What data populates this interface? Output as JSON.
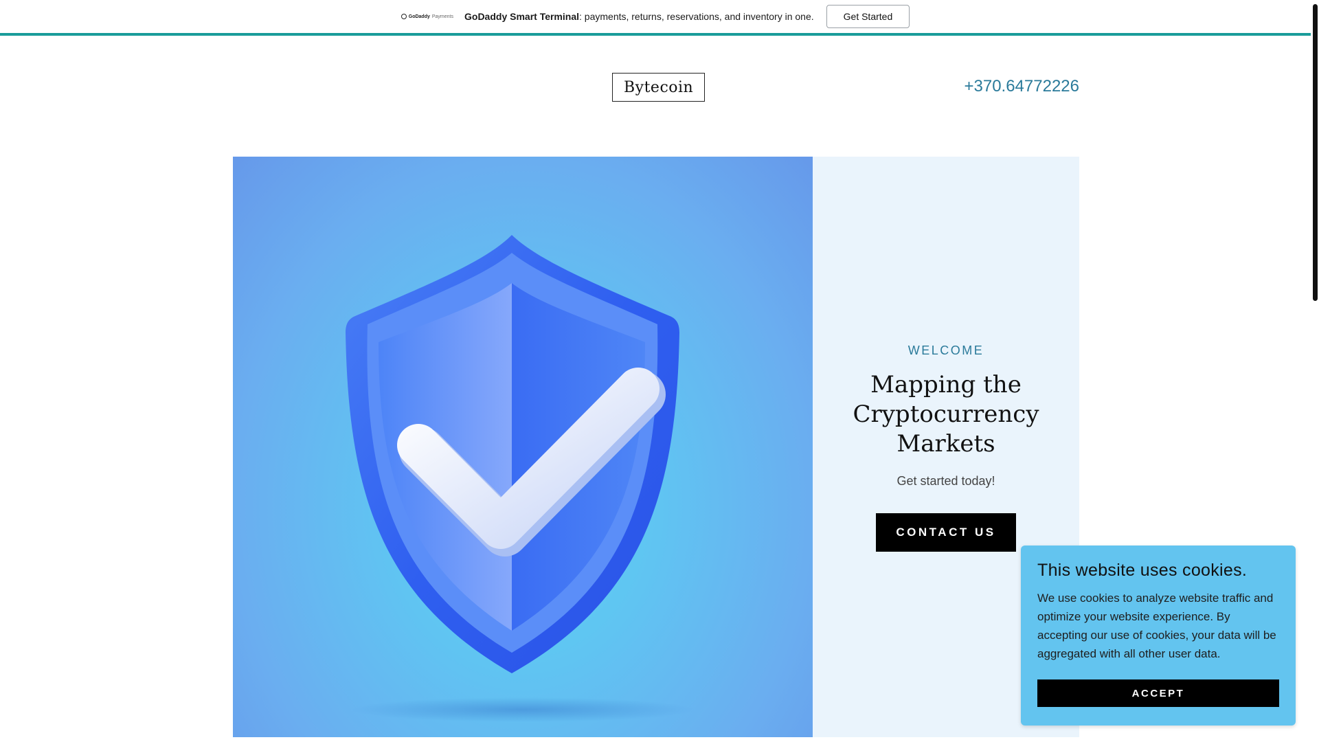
{
  "promo": {
    "logo_brand": "GoDaddy",
    "logo_sub": "Payments",
    "product": "GoDaddy Smart Terminal",
    "text": ": payments, returns, reservations, and inventory in one.",
    "button": "Get Started"
  },
  "header": {
    "logo": "Bytecoin",
    "phone": "+370.64772226"
  },
  "hero": {
    "image_icon": "shield-check-icon",
    "eyebrow": "WELCOME",
    "headline": "Mapping the Cryptocurrency Markets",
    "tagline": "Get started today!",
    "cta": "CONTACT US"
  },
  "cookie": {
    "title": "This website uses cookies.",
    "text": "We use cookies to analyze website traffic and optimize your website experience. By accepting our use of cookies, your data will be aggregated with all other user data.",
    "button": "ACCEPT"
  },
  "colors": {
    "accent_teal": "#1a9c9a",
    "link_blue": "#2a7a9a",
    "panel_bg": "#eaf4fc",
    "cookie_bg": "#63c4ef"
  }
}
